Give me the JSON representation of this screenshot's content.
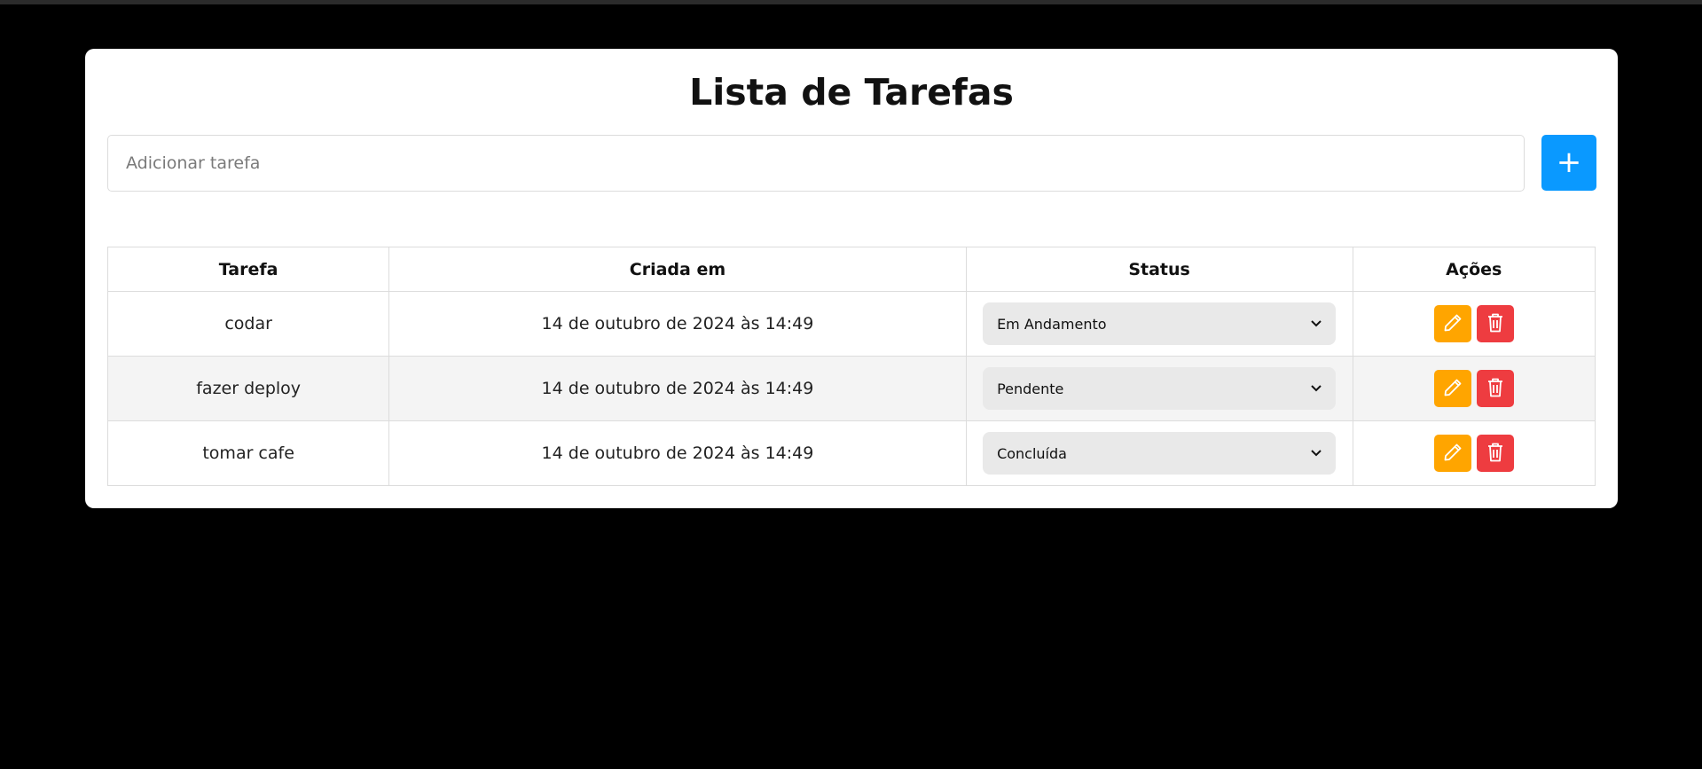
{
  "page": {
    "title": "Lista de Tarefas"
  },
  "add_task": {
    "placeholder": "Adicionar tarefa",
    "value": "",
    "button_label": "+"
  },
  "table": {
    "headers": {
      "task": "Tarefa",
      "created": "Criada em",
      "status": "Status",
      "actions": "Ações"
    },
    "rows": [
      {
        "task": "codar",
        "created": "14 de outubro de 2024 às 14:49",
        "status": "Em Andamento"
      },
      {
        "task": "fazer deploy",
        "created": "14 de outubro de 2024 às 14:49",
        "status": "Pendente"
      },
      {
        "task": "tomar cafe",
        "created": "14 de outubro de 2024 às 14:49",
        "status": "Concluída"
      }
    ],
    "status_options": [
      "Pendente",
      "Em Andamento",
      "Concluída"
    ]
  },
  "icons": {
    "add": "plus-icon",
    "edit": "pencil-icon",
    "delete": "trash-icon",
    "dropdown": "chevron-down-icon"
  },
  "colors": {
    "accent": "#0a99ff",
    "edit": "#ffa500",
    "delete": "#ee3c40",
    "background": "#000000",
    "card": "#ffffff",
    "row_alt": "#f4f4f4"
  }
}
